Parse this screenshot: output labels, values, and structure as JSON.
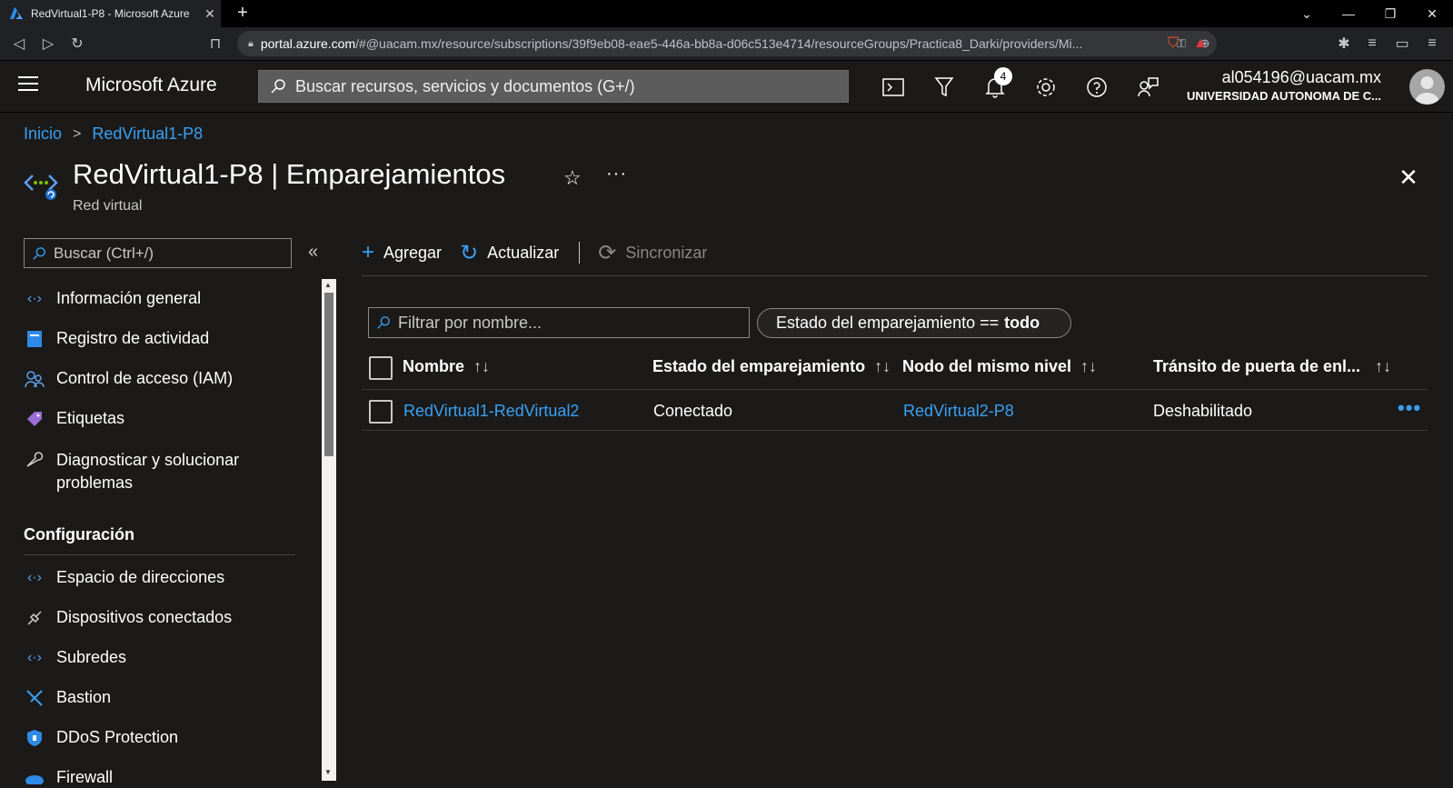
{
  "browser": {
    "tab_title": "RedVirtual1-P8 - Microsoft Azure",
    "url_host": "portal.azure.com",
    "url_rest": "/#@uacam.mx/resource/subscriptions/39f9eb08-eae5-446a-bb8a-d06c513e4714/resourceGroups/Practica8_Darki/providers/Mi...",
    "new_tab": "+",
    "tab_close": "✕"
  },
  "topbar": {
    "brand": "Microsoft Azure",
    "search_placeholder": "Buscar recursos, servicios y documentos (G+/)",
    "notification_count": "4",
    "account_name": "al054196@uacam.mx",
    "account_org": "UNIVERSIDAD AUTONOMA DE C..."
  },
  "breadcrumb": {
    "home": "Inicio",
    "separator": ">",
    "current": "RedVirtual1-P8"
  },
  "header": {
    "title": "RedVirtual1-P8 | Emparejamientos",
    "subtitle": "Red virtual"
  },
  "sidebar": {
    "search_placeholder": "Buscar (Ctrl+/)",
    "items": [
      {
        "label": "Información general",
        "icon": "vnet-icon"
      },
      {
        "label": "Registro de actividad",
        "icon": "activity-log-icon"
      },
      {
        "label": "Control de acceso (IAM)",
        "icon": "iam-icon"
      },
      {
        "label": "Etiquetas",
        "icon": "tag-icon"
      },
      {
        "label": "Diagnosticar y solucionar problemas",
        "icon": "wrench-icon"
      }
    ],
    "section": "Configuración",
    "config_items": [
      {
        "label": "Espacio de direcciones",
        "icon": "vnet-icon"
      },
      {
        "label": "Dispositivos conectados",
        "icon": "plug-icon"
      },
      {
        "label": "Subredes",
        "icon": "vnet-icon"
      },
      {
        "label": "Bastion",
        "icon": "bastion-icon"
      },
      {
        "label": "DDoS Protection",
        "icon": "shield-icon"
      },
      {
        "label": "Firewall",
        "icon": "firewall-icon"
      }
    ]
  },
  "commands": {
    "add": "Agregar",
    "refresh": "Actualizar",
    "sync": "Sincronizar"
  },
  "filter": {
    "placeholder": "Filtrar por nombre...",
    "pill_label": "Estado del emparejamiento ==",
    "pill_value": "todo"
  },
  "table": {
    "columns": [
      "Nombre",
      "Estado del emparejamiento",
      "Nodo del mismo nivel",
      "Tránsito de puerta de enl..."
    ],
    "sort_glyph": "↑↓",
    "rows": [
      {
        "name": "RedVirtual1-RedVirtual2",
        "state": "Conectado",
        "peer": "RedVirtual2-P8",
        "gateway": "Deshabilitado"
      }
    ]
  },
  "colors": {
    "background": "#1b1a19",
    "accent": "#3aa0f3",
    "border": "#8a8886"
  }
}
